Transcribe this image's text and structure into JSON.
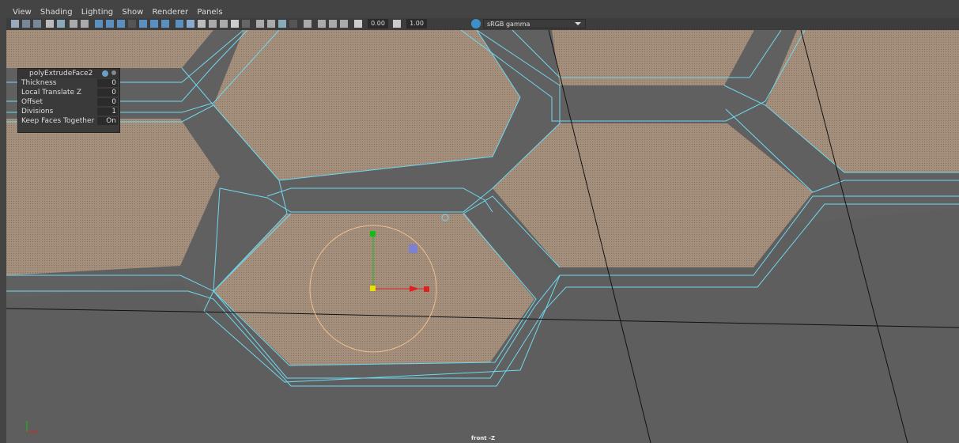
{
  "menu": [
    "View",
    "Shading",
    "Lighting",
    "Show",
    "Renderer",
    "Panels"
  ],
  "toolbar": {
    "exposure": "0.00",
    "gamma": "1.00",
    "color_space": "sRGB gamma",
    "icons": [
      "camera-icon",
      "grid-icon",
      "shaded-icon",
      "wireframe-icon",
      "light-icon",
      "shadow-icon",
      "isolate-icon",
      "xray-icon"
    ]
  },
  "inspector": {
    "title": "polyExtrudeFace2",
    "rows": [
      {
        "label": "Thickness",
        "value": "0"
      },
      {
        "label": "Local Translate Z",
        "value": "0"
      },
      {
        "label": "Offset",
        "value": "0"
      },
      {
        "label": "Divisions",
        "value": "1"
      },
      {
        "label": "Keep Faces Together",
        "value": "On"
      }
    ]
  },
  "viewport": {
    "camera_label": "front -Z",
    "colors": {
      "background": "#5e5e5e",
      "face_fill": "#a48f7c",
      "band_fill": "#606060",
      "edge": "#6ed8f0",
      "manip_x": "#e02020",
      "manip_y": "#10c010",
      "manip_center": "#e8e000",
      "rotate_ring": "#f0c090"
    }
  }
}
